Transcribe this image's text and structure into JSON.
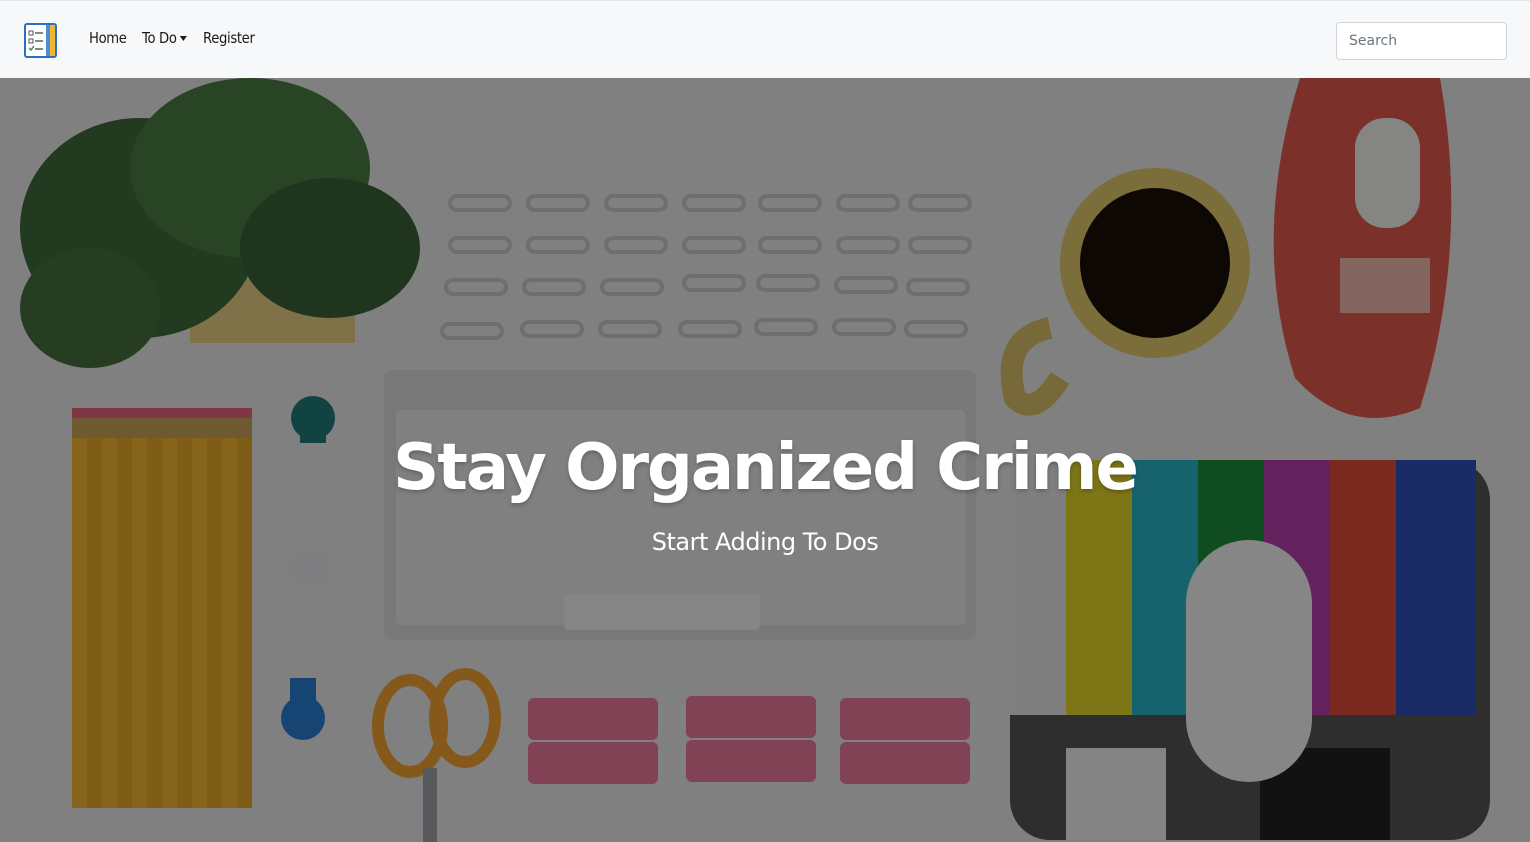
{
  "navbar": {
    "brand_icon": "todo-list-icon",
    "links": [
      {
        "label": "Home"
      },
      {
        "label": "To Do",
        "dropdown": true
      },
      {
        "label": "Register"
      }
    ],
    "search": {
      "placeholder": "Search",
      "value": ""
    }
  },
  "hero": {
    "title": "Stay Organized Crime",
    "subtitle": "Start Adding To Dos"
  },
  "colors": {
    "navbar_bg": "#f7f8fa",
    "overlay": "rgba(0,0,0,0.45)",
    "text_light": "#ffffff"
  }
}
